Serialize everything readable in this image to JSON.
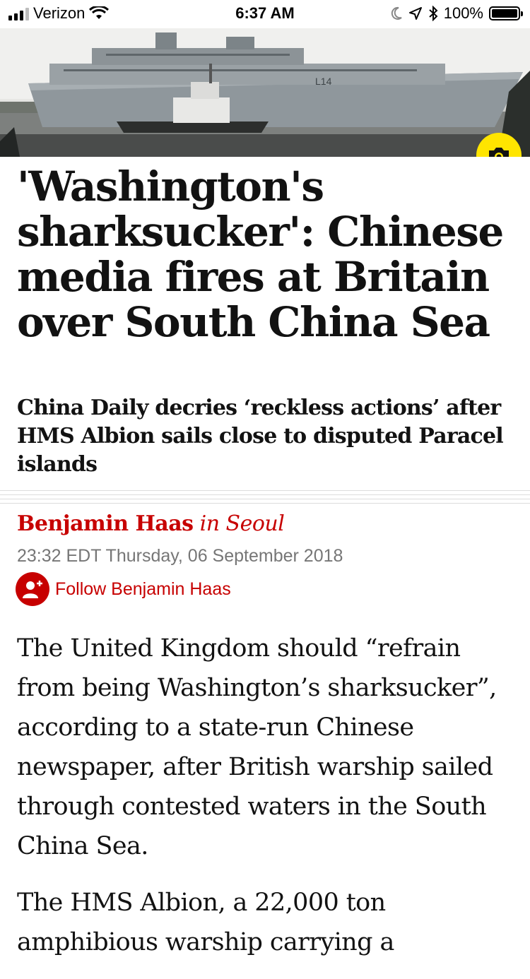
{
  "status_bar": {
    "carrier": "Verizon",
    "time": "6:37 AM",
    "battery": "100%"
  },
  "hero": {
    "ship_marking": "L14"
  },
  "article": {
    "headline": "'Washington's sharksucker': Chinese media fires at Britain over South China Sea",
    "standfirst": "China Daily decries ‘reckless actions’ after HMS Albion sails close to disputed Paracel islands",
    "byline_name": "Benjamin Haas",
    "byline_location": "in Seoul",
    "dateline": "23:32 EDT Thursday, 06 September 2018",
    "follow_label": "Follow Benjamin Haas",
    "paragraphs": [
      "The United Kingdom should “refrain from being Washington’s sharksucker”, according to a state-run Chinese newspaper, after British warship sailed through contested waters in the South China Sea.",
      "The HMS Albion, a 22,000 ton amphibious warship carrying a"
    ]
  },
  "colors": {
    "accent": "#c70000",
    "camera_button": "#ffe500",
    "text": "#121212",
    "meta": "#767676"
  },
  "icons": [
    "signal-icon",
    "wifi-icon",
    "moon-icon",
    "location-icon",
    "bluetooth-icon",
    "battery-icon",
    "camera-icon",
    "follow-user-icon"
  ]
}
